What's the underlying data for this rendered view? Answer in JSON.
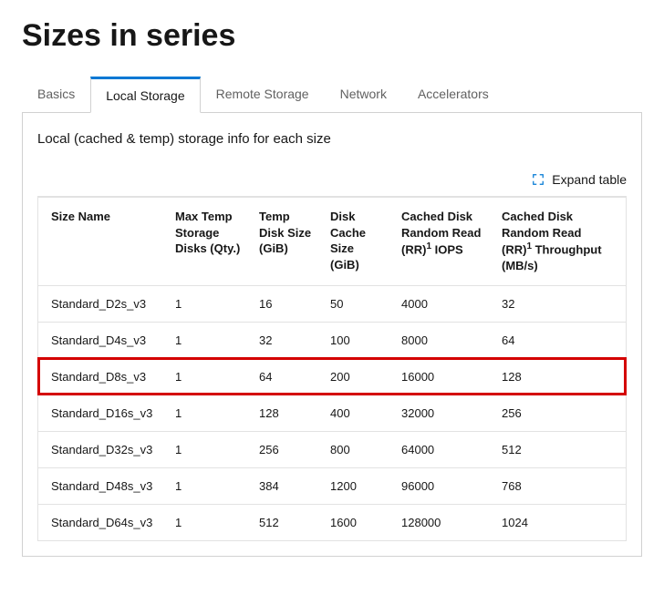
{
  "title": "Sizes in series",
  "tabs": {
    "basics": "Basics",
    "local_storage": "Local Storage",
    "remote_storage": "Remote Storage",
    "network": "Network",
    "accelerators": "Accelerators"
  },
  "panel": {
    "description": "Local (cached & temp) storage info for each size",
    "expand_label": "Expand table"
  },
  "table": {
    "headers": {
      "size_name": "Size Name",
      "max_temp_disks": "Max Temp Storage Disks (Qty.)",
      "temp_disk_size": "Temp Disk Size (GiB)",
      "disk_cache_size": "Disk Cache Size (GiB)",
      "cached_iops_pre": "Cached Disk Random Read (RR)",
      "cached_iops_post": " IOPS",
      "cached_tp_pre": "Cached Disk Random Read (RR)",
      "cached_tp_post": " Throughput (MB/s)",
      "sup": "1"
    },
    "rows": [
      {
        "size_name": "Standard_D2s_v3",
        "qty": "1",
        "temp": "16",
        "cache": "50",
        "iops": "4000",
        "tp": "32",
        "highlight": false
      },
      {
        "size_name": "Standard_D4s_v3",
        "qty": "1",
        "temp": "32",
        "cache": "100",
        "iops": "8000",
        "tp": "64",
        "highlight": false
      },
      {
        "size_name": "Standard_D8s_v3",
        "qty": "1",
        "temp": "64",
        "cache": "200",
        "iops": "16000",
        "tp": "128",
        "highlight": true
      },
      {
        "size_name": "Standard_D16s_v3",
        "qty": "1",
        "temp": "128",
        "cache": "400",
        "iops": "32000",
        "tp": "256",
        "highlight": false
      },
      {
        "size_name": "Standard_D32s_v3",
        "qty": "1",
        "temp": "256",
        "cache": "800",
        "iops": "64000",
        "tp": "512",
        "highlight": false
      },
      {
        "size_name": "Standard_D48s_v3",
        "qty": "1",
        "temp": "384",
        "cache": "1200",
        "iops": "96000",
        "tp": "768",
        "highlight": false
      },
      {
        "size_name": "Standard_D64s_v3",
        "qty": "1",
        "temp": "512",
        "cache": "1600",
        "iops": "128000",
        "tp": "1024",
        "highlight": false
      }
    ]
  }
}
